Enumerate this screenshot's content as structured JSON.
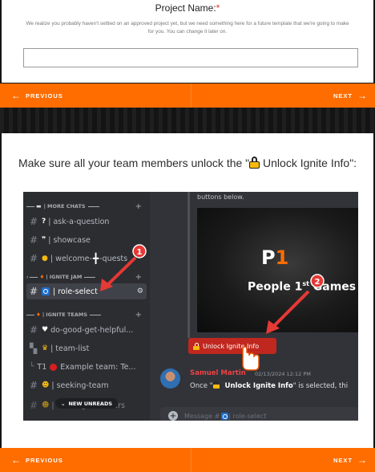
{
  "project": {
    "label": "Project Name:",
    "required_mark": "*",
    "help_text": "We realize you probably haven't settled on an approved project yet, but we need something here for a future template that we're going to make for you. You can change it later on.",
    "input_value": ""
  },
  "nav": {
    "prev_label": "PREVIOUS",
    "next_label": "NEXT",
    "prev_arrow": "←",
    "next_arrow": "→"
  },
  "instruction": {
    "before": "Make sure all your team members unlock the \"",
    "highlight": " Unlock Ignite Info",
    "after": "\":"
  },
  "discord": {
    "sidebar": {
      "cat_more_chats": "MORE CHATS",
      "cat_ignite_jam": "IGNITE JAM",
      "cat_ignite_teams": "IGNITE TEAMS",
      "channels": {
        "ask": "ask-a-question",
        "showcase": "showcase",
        "welcome": "welcome-",
        "welcome_tail": "-quests",
        "role_select": "role-select",
        "do_good": "do-good-get-helpful...",
        "team_list": "team-list",
        "t1_prefix": "T1",
        "example_team": "Example team: Te...",
        "seeking_team": "seeking-team",
        "seeking_members": "seeking-members"
      },
      "new_unreads": "NEW UNREADS"
    },
    "main": {
      "buttons_below": "buttons below.",
      "banner_p": "P",
      "banner_1": "1",
      "banner_people": "People 1",
      "banner_sup": "st",
      "banner_games": " Games",
      "unlock_button": "Unlock Ignite Info",
      "author": "Samuel Martin",
      "timestamp": "02/13/2024 12:12 PM",
      "msg_prefix": "Once \"",
      "msg_bold": " Unlock Ignite Info",
      "msg_suffix": "\" is selected, thi",
      "composer_placeholder": "Message #",
      "composer_channel": " | role-select"
    },
    "annotations": {
      "badge1": "1",
      "badge2": "2"
    },
    "colors": {
      "accent_orange": "#ff6d00",
      "annotation_red": "#e53935",
      "discord_bg": "#313338"
    }
  }
}
